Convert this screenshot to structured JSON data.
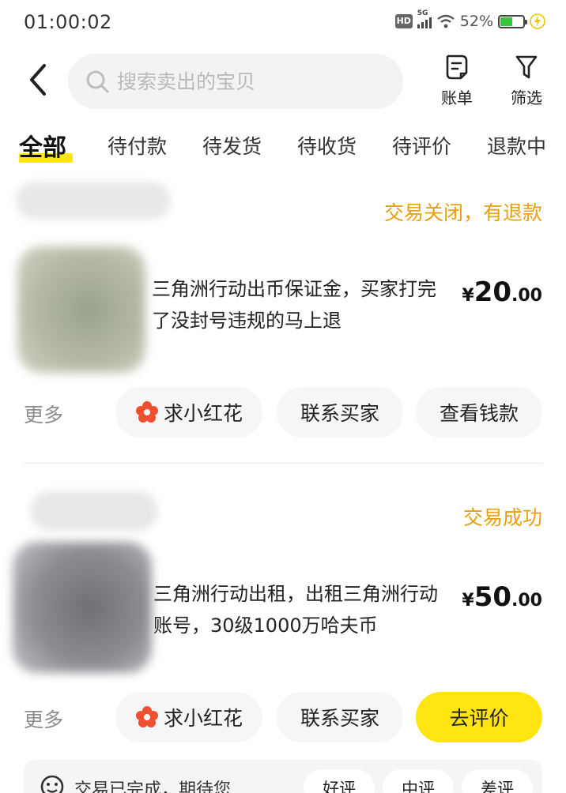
{
  "status_bar": {
    "time": "01:00:02",
    "network": "5G",
    "hd": "HD",
    "battery_percent": "52%",
    "battery_level": 0.52
  },
  "header": {
    "search_placeholder": "搜索卖出的宝贝",
    "bill_label": "账单",
    "filter_label": "筛选"
  },
  "tabs": [
    {
      "label": "全部",
      "active": true
    },
    {
      "label": "待付款"
    },
    {
      "label": "待发货"
    },
    {
      "label": "待收货"
    },
    {
      "label": "待评价"
    },
    {
      "label": "退款中"
    }
  ],
  "orders": [
    {
      "status": "交易关闭，有退款",
      "title": "三角洲行动出币保证金，买家打完了没封号违规的马上退",
      "price_symbol": "¥",
      "price_int": "20",
      "price_dec": ".00",
      "more_label": "更多",
      "actions": [
        "求小红花",
        "联系买家",
        "查看钱款"
      ]
    },
    {
      "status": "交易成功",
      "title": "三角洲行动出租，出租三角洲行动账号，30级1000万哈夫币",
      "price_symbol": "¥",
      "price_int": "50",
      "price_dec": ".00",
      "more_label": "更多",
      "actions": [
        "求小红花",
        "联系买家",
        "去评价"
      ]
    }
  ],
  "review_prompt": {
    "message": "交易已完成，期待您…",
    "options": [
      "好评",
      "中评",
      "差评"
    ]
  },
  "colors": {
    "accent_yellow": "#ffe510",
    "status_orange": "#e8a011",
    "flower_red": "#f0502f"
  }
}
